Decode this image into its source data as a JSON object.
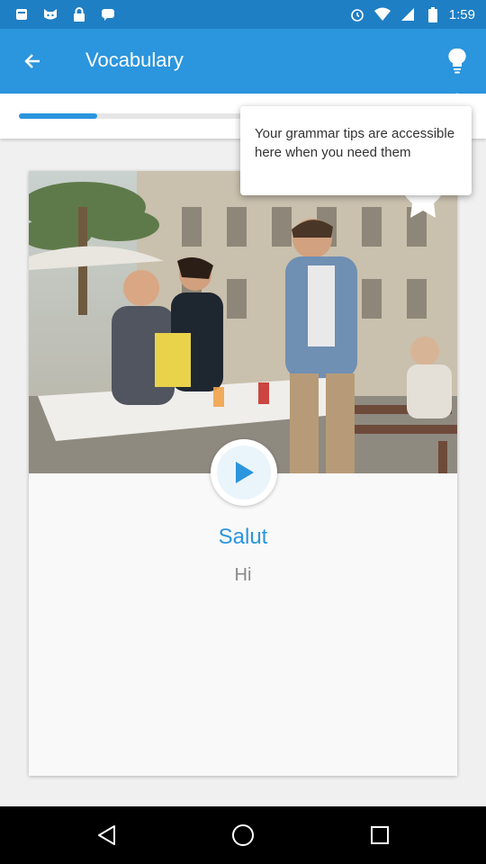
{
  "status_bar": {
    "time": "1:59",
    "icons": [
      "notification-icon",
      "cat-icon",
      "lock-icon",
      "chat-icon",
      "alarm-icon",
      "wifi-icon",
      "signal-icon",
      "battery-icon"
    ]
  },
  "app_bar": {
    "title": "Vocabulary",
    "back_icon": "back-arrow-icon",
    "tips_icon": "lightbulb-icon"
  },
  "progress": {
    "fraction": 0.29
  },
  "tooltip": {
    "text": "Your grammar tips are accessible here when you need them"
  },
  "card": {
    "word": "Salut",
    "translation": "Hi",
    "play_icon": "play-icon"
  },
  "colors": {
    "primary": "#2b95dd",
    "status_bar": "#1f7fc4",
    "accent_light": "#eaf4fb"
  }
}
